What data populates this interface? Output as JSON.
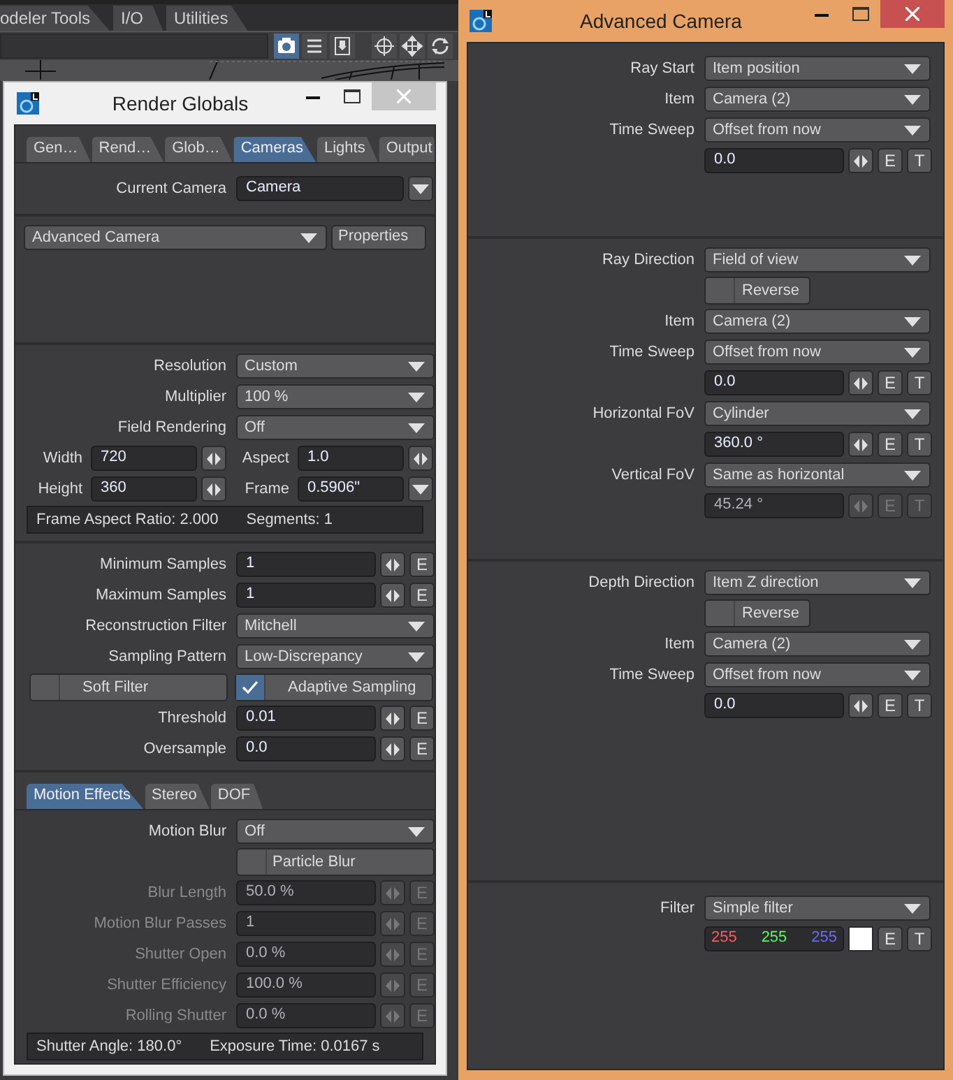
{
  "background_app": {
    "tabs": [
      {
        "label": "odeler Tools"
      },
      {
        "label": "I/O"
      },
      {
        "label": "Utilities"
      }
    ],
    "toolbar": [
      {
        "selected": true
      },
      {
        "selected": false
      },
      {
        "selected": false
      },
      {
        "selected": false
      },
      {
        "selected": false
      },
      {
        "selected": false
      }
    ]
  },
  "render_globals": {
    "title": "Render Globals",
    "tabs": [
      {
        "label": "Gen…",
        "selected": false
      },
      {
        "label": "Rend…",
        "selected": false
      },
      {
        "label": "Glob…",
        "selected": false
      },
      {
        "label": "Cameras",
        "selected": true
      },
      {
        "label": "Lights",
        "selected": false
      },
      {
        "label": "Output",
        "selected": false
      }
    ],
    "sections": [
      {
        "rows": [
          {
            "kind": "select_split",
            "label": "Current Camera",
            "value": "Camera"
          }
        ]
      },
      {
        "rows": [
          {
            "kind": "select_button",
            "value": "Advanced Camera",
            "button": "Properties"
          }
        ]
      },
      {
        "rows": [
          {
            "kind": "select",
            "label": "Resolution",
            "value": "Custom"
          },
          {
            "kind": "select",
            "label": "Multiplier",
            "value": "100 %"
          },
          {
            "kind": "select",
            "label": "Field Rendering",
            "value": "Off"
          },
          {
            "kind": "dim_pair",
            "items": [
              {
                "label": "Width",
                "value": "720",
                "kind": "spin"
              },
              {
                "label": "Aspect",
                "value": "1.0",
                "kind": "spin"
              }
            ]
          },
          {
            "kind": "dim_pair",
            "items": [
              {
                "label": "Height",
                "value": "360",
                "kind": "spin"
              },
              {
                "label": "Frame",
                "value": "0.5906\"",
                "kind": "menu"
              }
            ]
          },
          {
            "kind": "info",
            "texts": [
              "Frame Aspect Ratio: 2.000",
              "Segments: 1"
            ]
          }
        ]
      },
      {
        "rows": [
          {
            "kind": "number",
            "label": "Minimum Samples",
            "value": "1",
            "buttons": [
              "E"
            ],
            "disabled": false
          },
          {
            "kind": "number",
            "label": "Maximum Samples",
            "value": "1",
            "buttons": [
              "E"
            ],
            "disabled": false
          },
          {
            "kind": "select",
            "label": "Reconstruction Filter",
            "value": "Mitchell"
          },
          {
            "kind": "select",
            "label": "Sampling Pattern",
            "value": "Low-Discrepancy"
          },
          {
            "kind": "check_pair",
            "items": [
              {
                "label": "Soft Filter",
                "checked": false
              },
              {
                "label": "Adaptive Sampling",
                "checked": true
              }
            ]
          },
          {
            "kind": "number",
            "label": "Threshold",
            "value": "0.01",
            "buttons": [
              "E"
            ],
            "disabled": false
          },
          {
            "kind": "number",
            "label": "Oversample",
            "value": "0.0",
            "buttons": [
              "E"
            ],
            "disabled": false
          }
        ]
      }
    ],
    "subtabs": [
      {
        "label": "Motion Effects",
        "selected": true
      },
      {
        "label": "Stereo",
        "selected": false
      },
      {
        "label": "DOF",
        "selected": false
      }
    ],
    "subsection": {
      "rows": [
        {
          "kind": "select",
          "label": "Motion Blur",
          "value": "Off"
        },
        {
          "kind": "check",
          "label": "Particle Blur",
          "checked": false
        },
        {
          "kind": "number",
          "label": "Blur Length",
          "value": "50.0 %",
          "buttons": [
            "E"
          ],
          "disabled": true
        },
        {
          "kind": "number",
          "label": "Motion Blur Passes",
          "value": "1",
          "buttons": [
            "E"
          ],
          "disabled": true
        },
        {
          "kind": "number",
          "label": "Shutter Open",
          "value": "0.0 %",
          "buttons": [
            "E"
          ],
          "disabled": true
        },
        {
          "kind": "number",
          "label": "Shutter Efficiency",
          "value": "100.0 %",
          "buttons": [
            "E"
          ],
          "disabled": true
        },
        {
          "kind": "number",
          "label": "Rolling Shutter",
          "value": "0.0 %",
          "buttons": [
            "E"
          ],
          "disabled": true
        },
        {
          "kind": "info",
          "texts": [
            "Shutter Angle: 180.0°",
            "Exposure Time: 0.0167 s"
          ]
        }
      ]
    }
  },
  "advanced_camera": {
    "title": "Advanced Camera",
    "sections": [
      {
        "rows": [
          {
            "kind": "select",
            "label": "Ray Start",
            "value": "Item position"
          },
          {
            "kind": "select",
            "label": "Item",
            "value": "Camera (2)"
          },
          {
            "kind": "select",
            "label": "Time Sweep",
            "value": "Offset from now"
          },
          {
            "kind": "number",
            "value": "0.0",
            "buttons": [
              "E",
              "T"
            ],
            "disabled": false
          }
        ]
      },
      {
        "rows": [
          {
            "kind": "select",
            "label": "Ray Direction",
            "value": "Field of view"
          },
          {
            "kind": "check",
            "label": "Reverse",
            "checked": false
          },
          {
            "kind": "select",
            "label": "Item",
            "value": "Camera (2)"
          },
          {
            "kind": "select",
            "label": "Time Sweep",
            "value": "Offset from now"
          },
          {
            "kind": "number",
            "value": "0.0",
            "buttons": [
              "E",
              "T"
            ],
            "disabled": false
          },
          {
            "kind": "select",
            "label": "Horizontal FoV",
            "value": "Cylinder"
          },
          {
            "kind": "number",
            "value": "360.0 °",
            "buttons": [
              "E",
              "T"
            ],
            "disabled": false
          },
          {
            "kind": "select",
            "label": "Vertical FoV",
            "value": "Same as horizontal"
          },
          {
            "kind": "number",
            "value": "45.24 °",
            "buttons": [
              "E",
              "T"
            ],
            "disabled": true
          }
        ]
      },
      {
        "rows": [
          {
            "kind": "select",
            "label": "Depth Direction",
            "value": "Item Z direction"
          },
          {
            "kind": "check",
            "label": "Reverse",
            "checked": false
          },
          {
            "kind": "select",
            "label": "Item",
            "value": "Camera (2)"
          },
          {
            "kind": "select",
            "label": "Time Sweep",
            "value": "Offset from now"
          },
          {
            "kind": "number",
            "value": "0.0",
            "buttons": [
              "E",
              "T"
            ],
            "disabled": false
          }
        ]
      },
      {
        "rows": [
          {
            "kind": "select",
            "label": "Filter",
            "value": "Simple filter"
          },
          {
            "kind": "color",
            "values": [
              {
                "text": "255",
                "color": "#ff5a5a"
              },
              {
                "text": "255",
                "color": "#5aff5a"
              },
              {
                "text": "255",
                "color": "#6a6aff"
              }
            ],
            "swatch": {
              "color": "#ffffff"
            },
            "buttons": [
              "E",
              "T"
            ]
          }
        ]
      }
    ]
  }
}
